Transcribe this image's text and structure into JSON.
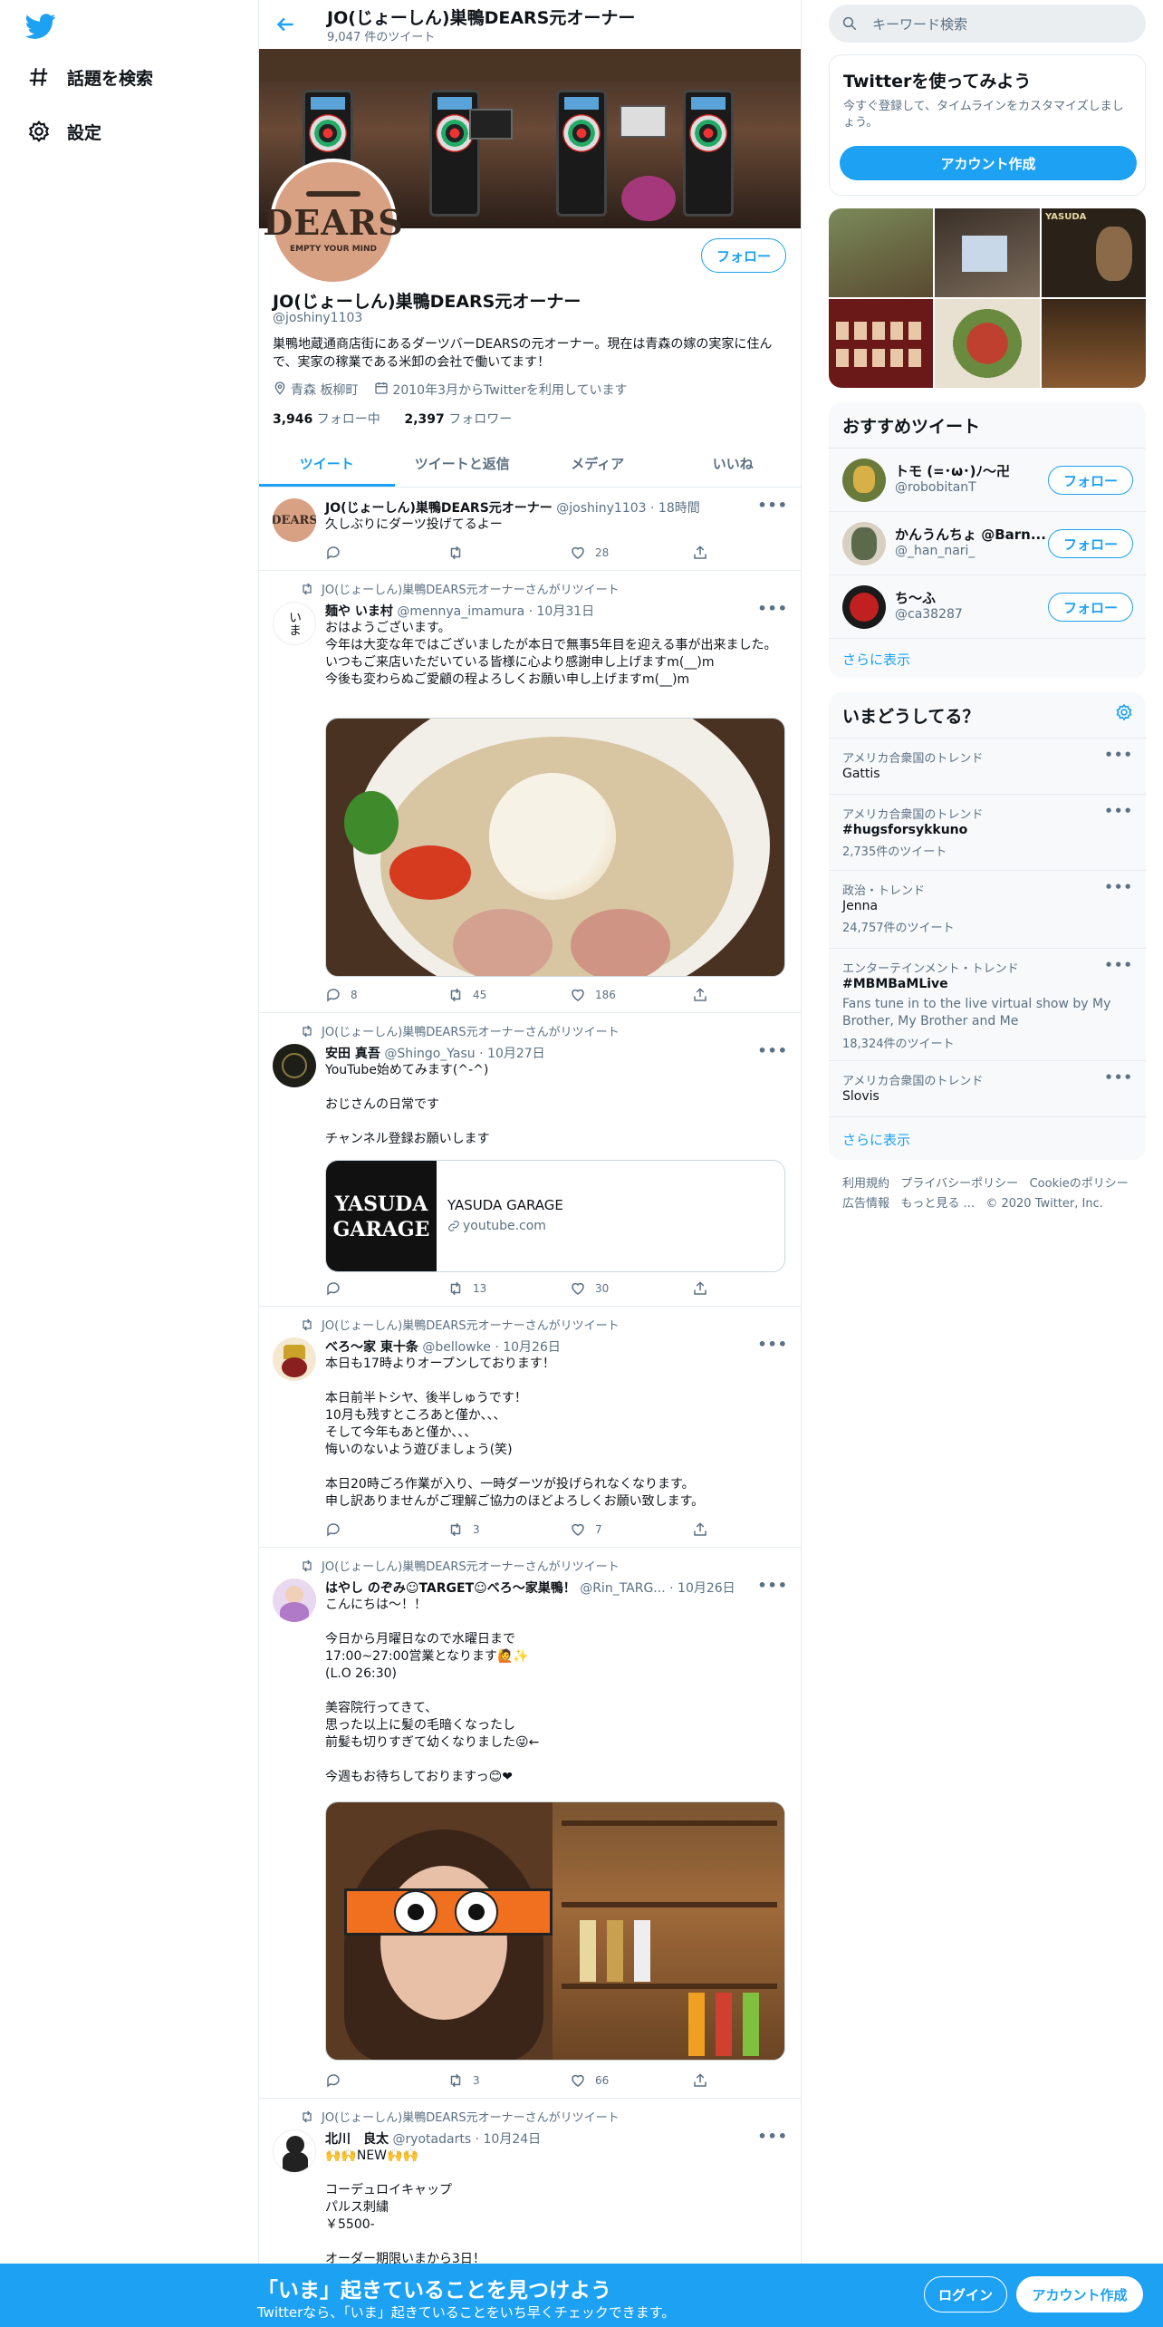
{
  "nav": {
    "items": [
      {
        "label": "話題を検索",
        "icon": "hash-icon"
      },
      {
        "label": "設定",
        "icon": "gear-icon"
      }
    ]
  },
  "header": {
    "name": "JO(じょーしん)巣鴨DEARS元オーナー",
    "tweet_count": "9,047 件のツイート"
  },
  "profile": {
    "avatar_text": "DEARS",
    "avatar_sub": "EMPTY YOUR MIND",
    "follow_label": "フォロー",
    "name": "JO(じょーしん)巣鴨DEARS元オーナー",
    "handle": "@joshiny1103",
    "bio": "巣鴨地蔵通商店街にあるダーツバーDEARSの元オーナー。現在は青森の嫁の実家に住んで、実家の稼業である米卸の会社で働いてます！",
    "location": "青森 板柳町",
    "joined": "2010年3月からTwitterを利用しています",
    "following_count": "3,946",
    "following_label": "フォロー中",
    "followers_count": "2,397",
    "followers_label": "フォロワー"
  },
  "tabs": [
    "ツイート",
    "ツイートと返信",
    "メディア",
    "いいね"
  ],
  "tweets": [
    {
      "name": "JO(じょーしん)巣鴨DEARS元オーナー",
      "handle": "@joshiny1103",
      "time": "18時間",
      "text": "久しぶりにダーツ投げてるよー",
      "reply": "",
      "retweet": "",
      "like": "28"
    },
    {
      "retweeted_by": "JO(じょーしん)巣鴨DEARS元オーナーさんがリツイート",
      "name": "麺や いま村",
      "handle": "@mennya_imamura",
      "time": "10月31日",
      "text": "おはようございます。\n今年は大変な年ではございましたが本日で無事5年目を迎える事が出来ました。\nいつもご来店いただいている皆様に心より感謝申し上げますm(__)m\n今後も変わらぬご愛顧の程よろしくお願い申し上げますm(__)m",
      "reply": "8",
      "retweet": "45",
      "like": "186"
    },
    {
      "retweeted_by": "JO(じょーしん)巣鴨DEARS元オーナーさんがリツイート",
      "name": "安田 真吾",
      "handle": "@Shingo_Yasu",
      "time": "10月27日",
      "text": "YouTube始めてみます(^-^)\n\nおじさんの日常です\n\nチャンネル登録お願いします",
      "link_title": "YASUDA GARAGE",
      "link_domain": "youtube.com",
      "link_thumb_text": "YASUDA GARAGE",
      "reply": "",
      "retweet": "13",
      "like": "30"
    },
    {
      "retweeted_by": "JO(じょーしん)巣鴨DEARS元オーナーさんがリツイート",
      "name": "べろ〜家 東十条",
      "handle": "@bellowke",
      "time": "10月26日",
      "text": "本日も17時よりオープンしております！\n\n本日前半トシヤ、後半しゅうです！\n10月も残すところあと僅か、、、\nそして今年もあと僅か、、、\n悔いのないよう遊びましょう(笑)\n\n本日20時ごろ作業が入り、一時ダーツが投げられなくなります。\n申し訳ありませんがご理解ご協力のほどよろしくお願い致します。",
      "reply": "",
      "retweet": "3",
      "like": "7"
    },
    {
      "retweeted_by": "JO(じょーしん)巣鴨DEARS元オーナーさんがリツイート",
      "name": "はやし のぞみ☺TARGET☺べろ〜家巣鴨！",
      "handle": "@Rin_TARG...",
      "time": "10月26日",
      "text": "こんにちは〜！！\n\n今日から月曜日なので水曜日まで\n17:00~27:00営業となります🙋✨\n(L.O 26:30)\n\n美容院行ってきて、\n思った以上に髪の毛暗くなったし\n前髪も切りすぎて幼くなりました😜←\n\n今週もお待ちしておりますっ😊❤",
      "reply": "",
      "retweet": "3",
      "like": "66"
    },
    {
      "retweeted_by": "JO(じょーしん)巣鴨DEARS元オーナーさんがリツイート",
      "name": "北川　良太",
      "handle": "@ryotadarts",
      "time": "10月24日",
      "text": "🙌🙌NEW🙌🙌\n\nコーデュロイキャップ\nパルス刺繍\n￥5500-\n\nオーダー期限いまから3日！"
    }
  ],
  "search": {
    "placeholder": "キーワード検索"
  },
  "signup_card": {
    "title": "Twitterを使ってみよう",
    "desc": "今すぐ登録して、タイムラインをカスタマイズしましょう。",
    "button": "アカウント作成"
  },
  "photo_grid_caption": "YASUDA",
  "suggestions": {
    "title": "おすすめツイート",
    "items": [
      {
        "name": "トモ (=･ω･)ﾉ〜卍",
        "handle": "@robobitanT",
        "button": "フォロー"
      },
      {
        "name": "かんうんちょ @Barn...",
        "handle": "@_han_nari_",
        "button": "フォロー"
      },
      {
        "name": "ち～ふ",
        "handle": "@ca38287",
        "button": "フォロー"
      }
    ],
    "show_more": "さらに表示"
  },
  "trends": {
    "title": "いまどうしてる？",
    "items": [
      {
        "category": "アメリカ合衆国のトレンド",
        "name": "Gattis",
        "desc": "",
        "count": ""
      },
      {
        "category": "アメリカ合衆国のトレンド",
        "name": "#hugsforsykkuno",
        "desc": "",
        "count": "2,735件のツイート"
      },
      {
        "category": "政治・トレンド",
        "name": "Jenna",
        "desc": "",
        "count": "24,757件のツイート"
      },
      {
        "category": "エンターテインメント・トレンド",
        "name": "#MBMBaMLive",
        "desc": "Fans tune in to the live virtual show by My Brother, My Brother and Me",
        "count": "18,324件のツイート"
      },
      {
        "category": "アメリカ合衆国のトレンド",
        "name": "Slovis",
        "desc": "",
        "count": ""
      }
    ],
    "show_more": "さらに表示"
  },
  "footer": {
    "links": [
      "利用規約",
      "プライバシーポリシー",
      "Cookieのポリシー",
      "広告情報",
      "もっと見る ..."
    ],
    "copyright": "© 2020 Twitter, Inc."
  },
  "bottom_bar": {
    "headline": "「いま」起きていることを見つけよう",
    "sub": "Twitterなら、「いま」起きていることをいち早くチェックできます。",
    "login": "ログイン",
    "signup": "アカウント作成"
  },
  "colors": {
    "accent": "#1da1f2",
    "text": "#0f1419",
    "muted": "#5b7083",
    "border": "#e6ecf0",
    "bottom_bar": "#1da1f2"
  }
}
